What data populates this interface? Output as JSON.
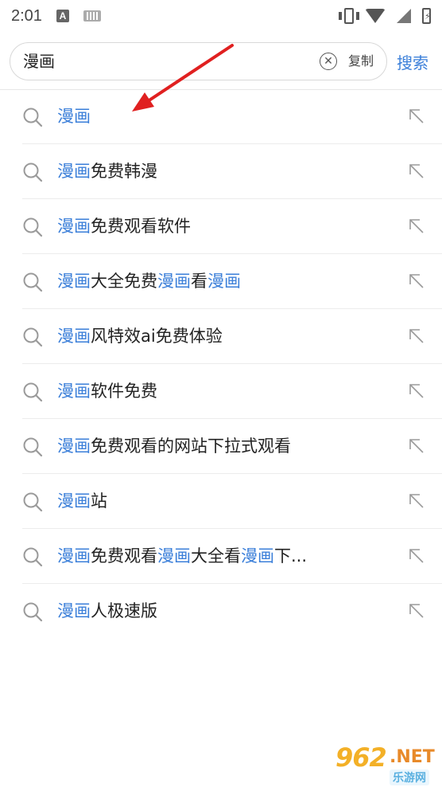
{
  "status_bar": {
    "time": "2:01",
    "indicator_a": "A"
  },
  "search": {
    "query": "漫画",
    "copy_label": "复制",
    "search_label": "搜索"
  },
  "suggestions": [
    {
      "highlight": "漫画",
      "rest": "",
      "extra": []
    },
    {
      "highlight": "漫画",
      "rest": "免费韩漫",
      "extra": []
    },
    {
      "highlight": "漫画",
      "rest": "免费观看软件",
      "extra": []
    },
    {
      "highlight": "漫画",
      "rest": "大全免费",
      "extra": [
        {
          "hl": "漫画",
          "t": "看"
        },
        {
          "hl": "漫画",
          "t": ""
        }
      ]
    },
    {
      "highlight": "漫画",
      "rest": "风特效ai免费体验",
      "extra": []
    },
    {
      "highlight": "漫画",
      "rest": "软件免费",
      "extra": []
    },
    {
      "highlight": "漫画",
      "rest": "免费观看的网站下拉式观看",
      "extra": []
    },
    {
      "highlight": "漫画",
      "rest": "站",
      "extra": []
    },
    {
      "highlight": "漫画",
      "rest": "免费观看",
      "extra": [
        {
          "hl": "漫画",
          "t": "大全看"
        },
        {
          "hl": "漫画",
          "t": "下..."
        }
      ]
    },
    {
      "highlight": "漫画",
      "rest": "人极速版",
      "extra": []
    }
  ],
  "watermark": {
    "number": "962",
    "net": ".NET",
    "site": "乐游网"
  },
  "colors": {
    "accent": "#3b7fd9",
    "annotation_arrow": "#e02020"
  }
}
